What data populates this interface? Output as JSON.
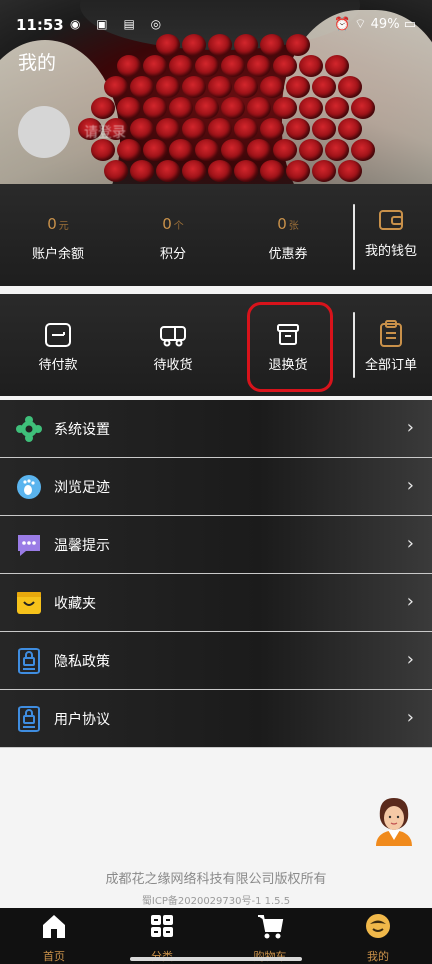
{
  "status_bar": {
    "time": "11:53",
    "battery": "49%"
  },
  "header": {
    "title": "我的",
    "username": "请登录"
  },
  "wallet": {
    "items": [
      {
        "value": "0",
        "unit": "元",
        "label": "账户余额"
      },
      {
        "value": "0",
        "unit": "个",
        "label": "积分"
      },
      {
        "value": "0",
        "unit": "张",
        "label": "优惠券"
      }
    ],
    "wallet_label": "我的钱包"
  },
  "orders": {
    "items": [
      {
        "label": "待付款",
        "icon": "wallet-card-icon"
      },
      {
        "label": "待收货",
        "icon": "truck-icon"
      },
      {
        "label": "退换货",
        "icon": "box-icon"
      }
    ],
    "all_label": "全部订单"
  },
  "menu": [
    {
      "label": "系统设置",
      "icon": "gear-icon"
    },
    {
      "label": "浏览足迹",
      "icon": "footprint-icon"
    },
    {
      "label": "温馨提示",
      "icon": "message-icon"
    },
    {
      "label": "收藏夹",
      "icon": "favorite-box-icon"
    },
    {
      "label": "隐私政策",
      "icon": "privacy-lock-icon"
    },
    {
      "label": "用户协议",
      "icon": "agreement-lock-icon"
    }
  ],
  "footer": {
    "copyright": "成都花之缘网络科技有限公司版权所有",
    "icp": "蜀ICP备2020029730号-1 1.5.5"
  },
  "tabbar": [
    {
      "label": "首页",
      "icon": "home-icon"
    },
    {
      "label": "分类",
      "icon": "category-icon"
    },
    {
      "label": "购物车",
      "icon": "cart-icon"
    },
    {
      "label": "我的",
      "icon": "profile-icon"
    }
  ],
  "colors": {
    "accent": "#c9914a",
    "highlight": "#d8131b"
  }
}
